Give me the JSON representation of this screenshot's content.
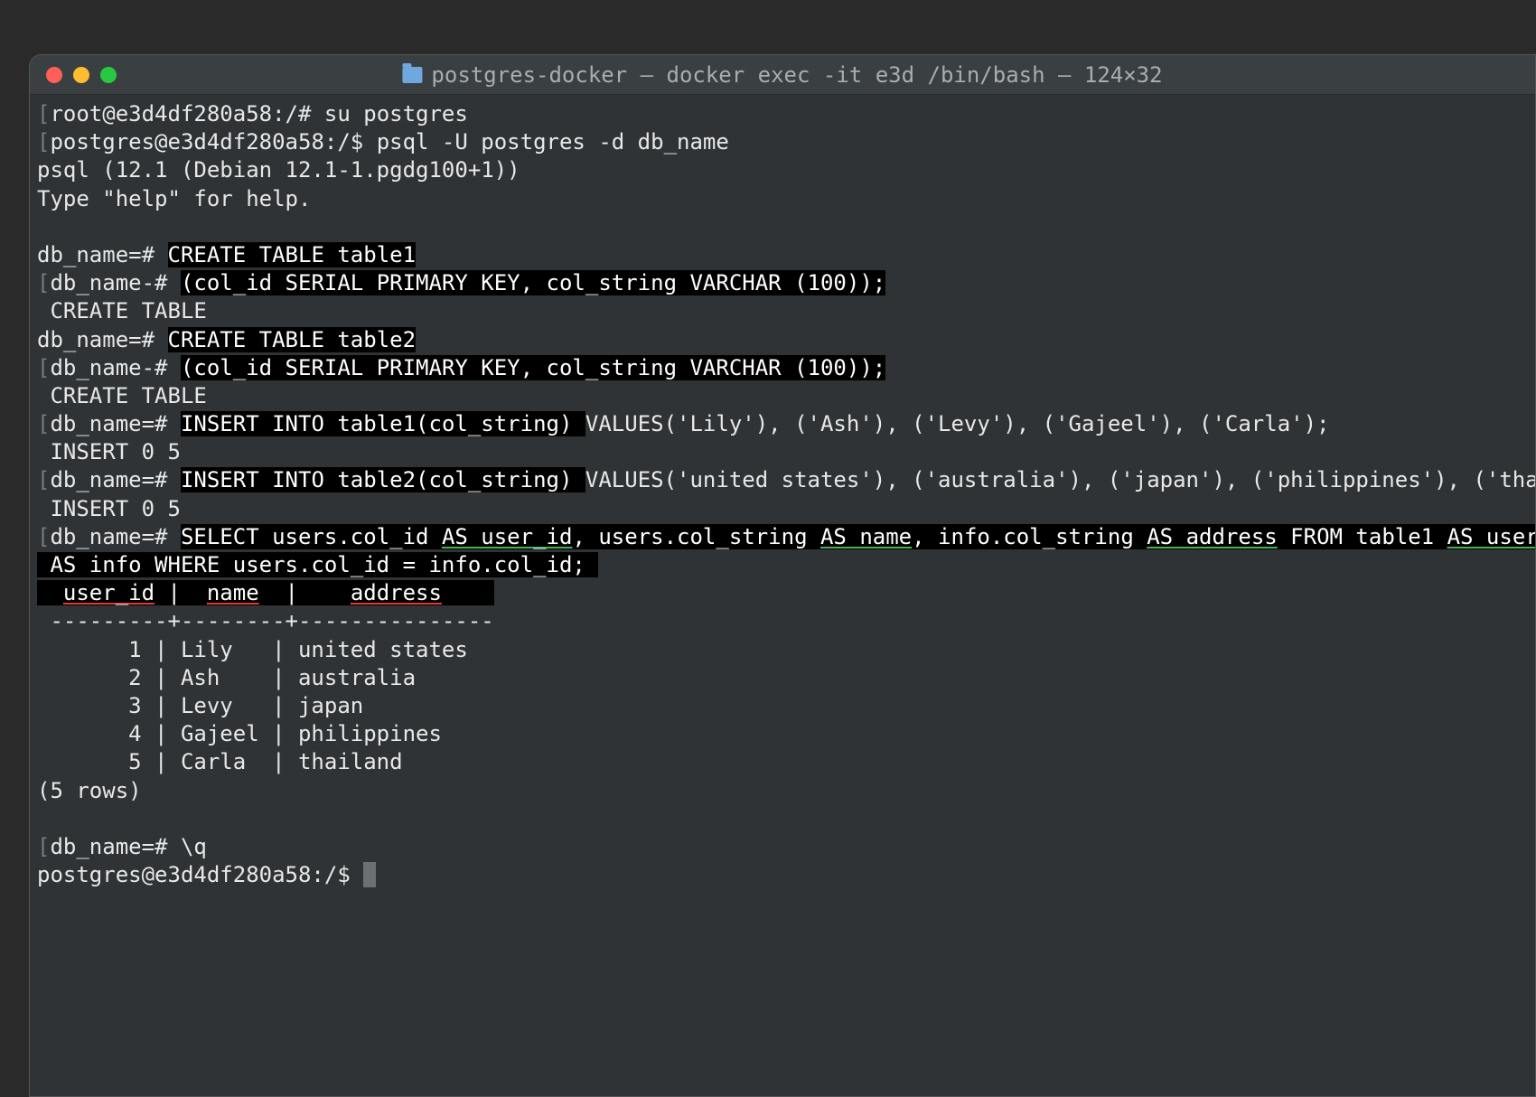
{
  "titlebar": {
    "title": "postgres-docker — docker exec -it e3d /bin/bash — 124×32"
  },
  "lines": {
    "l1_pre": "root@e3d4df280a58:/# ",
    "l1_cmd": "su postgres",
    "l2_pre": "postgres@e3d4df280a58:/$ ",
    "l2_cmd": "psql -U postgres -d db_name",
    "l3": "psql (12.1 (Debian 12.1-1.pgdg100+1))",
    "l4": "Type \"help\" for help.",
    "l5_pre": "db_name=# ",
    "l5_cmd": "CREATE TABLE table1",
    "l6_pre": "db_name-# ",
    "l6_cmd": "(col_id SERIAL PRIMARY KEY, col_string VARCHAR (100));",
    "l7": " CREATE TABLE",
    "l8_pre": "db_name=# ",
    "l8_cmd": "CREATE TABLE table2",
    "l9_pre": "db_name-# ",
    "l9_cmd": "(col_id SERIAL PRIMARY KEY, col_string VARCHAR (100));",
    "l10": " CREATE TABLE",
    "l11_pre": "db_name=# ",
    "l11_cmd": "INSERT INTO table1(col_string) ",
    "l11_tail": "VALUES('Lily'), ('Ash'), ('Levy'), ('Gajeel'), ('Carla');",
    "l12": " INSERT 0 5",
    "l13_pre": "db_name=# ",
    "l13_cmd": "INSERT INTO table2(col_string) ",
    "l13_tail": "VALUES('united states'), ('australia'), ('japan'), ('philippines'), ('thaila",
    "l14": " INSERT 0 5",
    "l15_pre": "db_name=# ",
    "l15a": "SELECT users.col_id ",
    "l15b": "AS user_id",
    "l15c": ", users.col_string ",
    "l15d": "AS name",
    "l15e": ", info.col_string ",
    "l15f": "AS address",
    "l15g": " FROM table1 ",
    "l15h": "AS users",
    "l15i": ", ",
    "l16a": " AS info WHERE users.col_id = info.col_id; ",
    "h_sp1": "  ",
    "h_uid": "user_id",
    "h_sp2": " |  ",
    "h_name": "name",
    "h_sp3": "  |    ",
    "h_addr": "address",
    "h_sp4": "    ",
    "sep": " ---------+--------+---------------",
    "r1": "       1 | Lily   | united states",
    "r2": "       2 | Ash    | australia",
    "r3": "       3 | Levy   | japan",
    "r4": "       4 | Gajeel | philippines",
    "r5": "       5 | Carla  | thailand",
    "rows": "(5 rows)",
    "q_pre": "db_name=# ",
    "q_cmd": "\\q",
    "last": "postgres@e3d4df280a58:/$ "
  }
}
